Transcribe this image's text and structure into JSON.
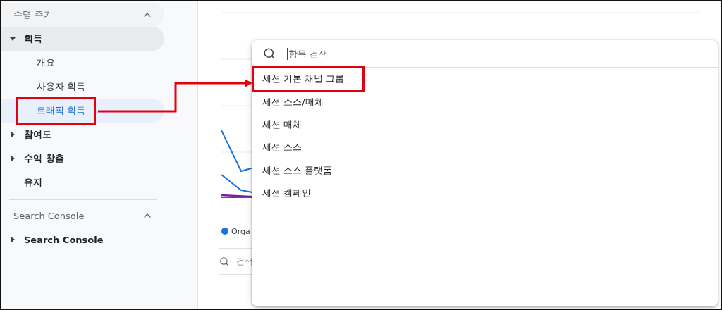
{
  "sidebar": {
    "sections": [
      {
        "title": "수명 주기",
        "expanded": true,
        "items": [
          {
            "label": "획득",
            "expanded": true,
            "has_children": true,
            "selected": false,
            "highlighted": false,
            "children": [
              {
                "label": "개요",
                "selected": false,
                "highlighted": false
              },
              {
                "label": "사용자 획득",
                "selected": false,
                "highlighted": false
              },
              {
                "label": "트래픽 획득",
                "selected": true,
                "highlighted": true
              }
            ]
          },
          {
            "label": "참여도",
            "expanded": false,
            "has_children": true,
            "selected": false,
            "highlighted": false
          },
          {
            "label": "수익 창출",
            "expanded": false,
            "has_children": true,
            "selected": false,
            "highlighted": false
          },
          {
            "label": "유지",
            "expanded": false,
            "has_children": false,
            "selected": false,
            "highlighted": false
          }
        ]
      },
      {
        "title": "Search Console",
        "expanded": true,
        "items": [
          {
            "label": "Search Console",
            "expanded": false,
            "has_children": true,
            "selected": false,
            "highlighted": false
          }
        ]
      }
    ]
  },
  "main": {
    "legend": [
      {
        "label": "Orga",
        "color": "#1a73e8"
      }
    ],
    "table_search": {
      "placeholder": "검색"
    }
  },
  "dropdown": {
    "search": {
      "placeholder": "항목 검색"
    },
    "options": [
      {
        "label": "세션 기본 채널 그룹",
        "highlighted": true
      },
      {
        "label": "세션 소스/매체",
        "highlighted": false
      },
      {
        "label": "세션 매체",
        "highlighted": false
      },
      {
        "label": "세션 소스",
        "highlighted": false
      },
      {
        "label": "세션 소스 플랫폼",
        "highlighted": false
      },
      {
        "label": "세션 캠페인",
        "highlighted": false
      }
    ]
  }
}
